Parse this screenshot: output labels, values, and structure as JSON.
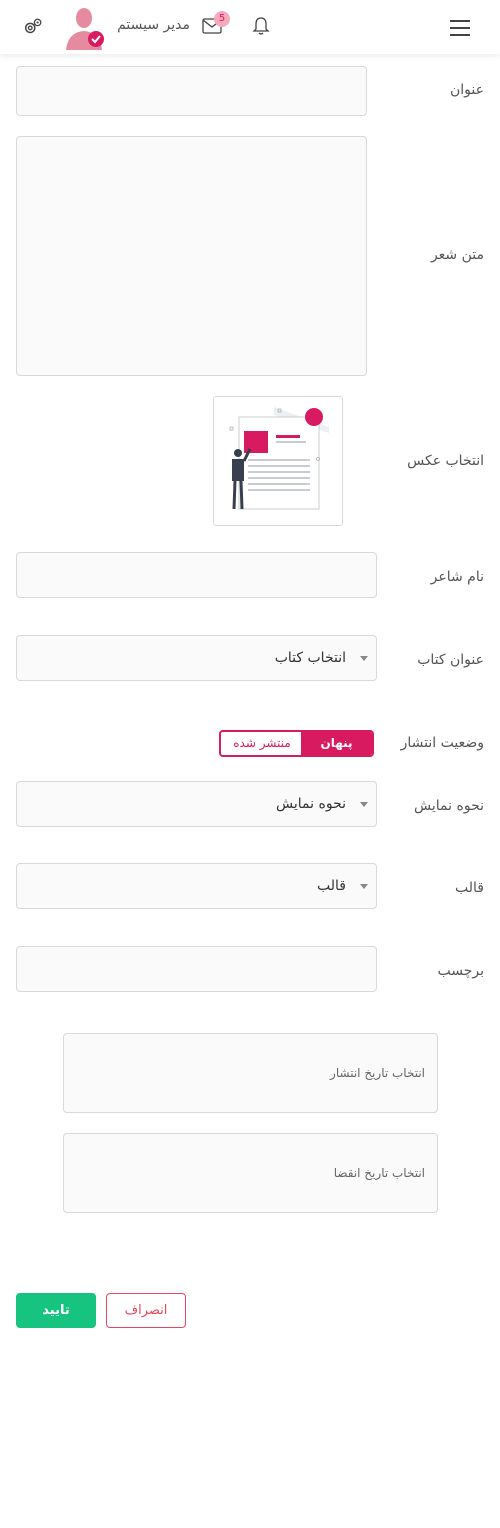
{
  "header": {
    "username": "مدیر سیستم",
    "mail_badge": "5",
    "icons": [
      "gear-icon",
      "avatar-icon",
      "mail-icon",
      "bell-icon",
      "hamburger-icon"
    ]
  },
  "form": {
    "title_label": "عنوان",
    "poem_text_label": "متن شعر",
    "image_label": "انتخاب عکس",
    "poet_name_label": "نام شاعر",
    "book_title_label": "عنوان کتاب",
    "book_select_value": "انتخاب کتاب",
    "publish_status_label": "وضعیت انتشار",
    "status_published": "منتشر شده",
    "status_hidden": "پنهان",
    "display_mode_label": "نحوه نمایش",
    "display_mode_value": "نحوه نمایش",
    "template_label": "قالب",
    "template_value": "قالب",
    "tag_label": "برچسب",
    "publish_date_placeholder": "انتخاب تاریخ انتشار",
    "expire_date_placeholder": "انتخاب تاریخ انقضا"
  },
  "actions": {
    "confirm": "تایید",
    "cancel": "انصراف"
  },
  "colors": {
    "accent": "#d81b60",
    "confirm": "#16c47f",
    "cancel": "#e8455f"
  }
}
